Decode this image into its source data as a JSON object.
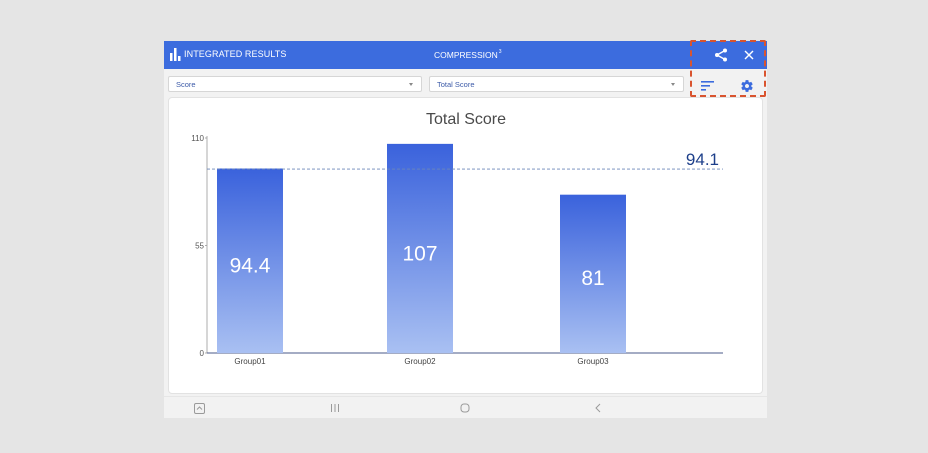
{
  "header": {
    "title": "INTEGRATED RESULTS",
    "center_title": "COMPRESSION",
    "center_sup": "3",
    "icons": [
      "bar-chart-icon",
      "share-icon",
      "close-icon"
    ]
  },
  "filters": {
    "metric": "Score",
    "submetric": "Total Score",
    "icons": [
      "sort-icon",
      "gear-icon"
    ]
  },
  "colors": {
    "accent": "#3c6cde",
    "bar_top": "#3a62dc",
    "bar_bottom": "#a9c0f2",
    "avg_line": "#6b86b8",
    "avg_text": "#1d3f8a",
    "highlight": "#d9542f"
  },
  "chart_data": {
    "type": "bar",
    "title": "Total Score",
    "categories": [
      "Group01",
      "Group02",
      "Group03"
    ],
    "values": [
      94.4,
      107,
      81
    ],
    "data_labels": [
      "94.4",
      "107",
      "81"
    ],
    "ylim": [
      0,
      110
    ],
    "yticks": [
      "0",
      "55",
      "110"
    ],
    "average": 94.1,
    "average_label": "94.1",
    "grid": false
  },
  "navbar": {
    "icons": [
      "screenshot-icon",
      "recent-apps-icon",
      "home-icon",
      "back-icon"
    ]
  }
}
